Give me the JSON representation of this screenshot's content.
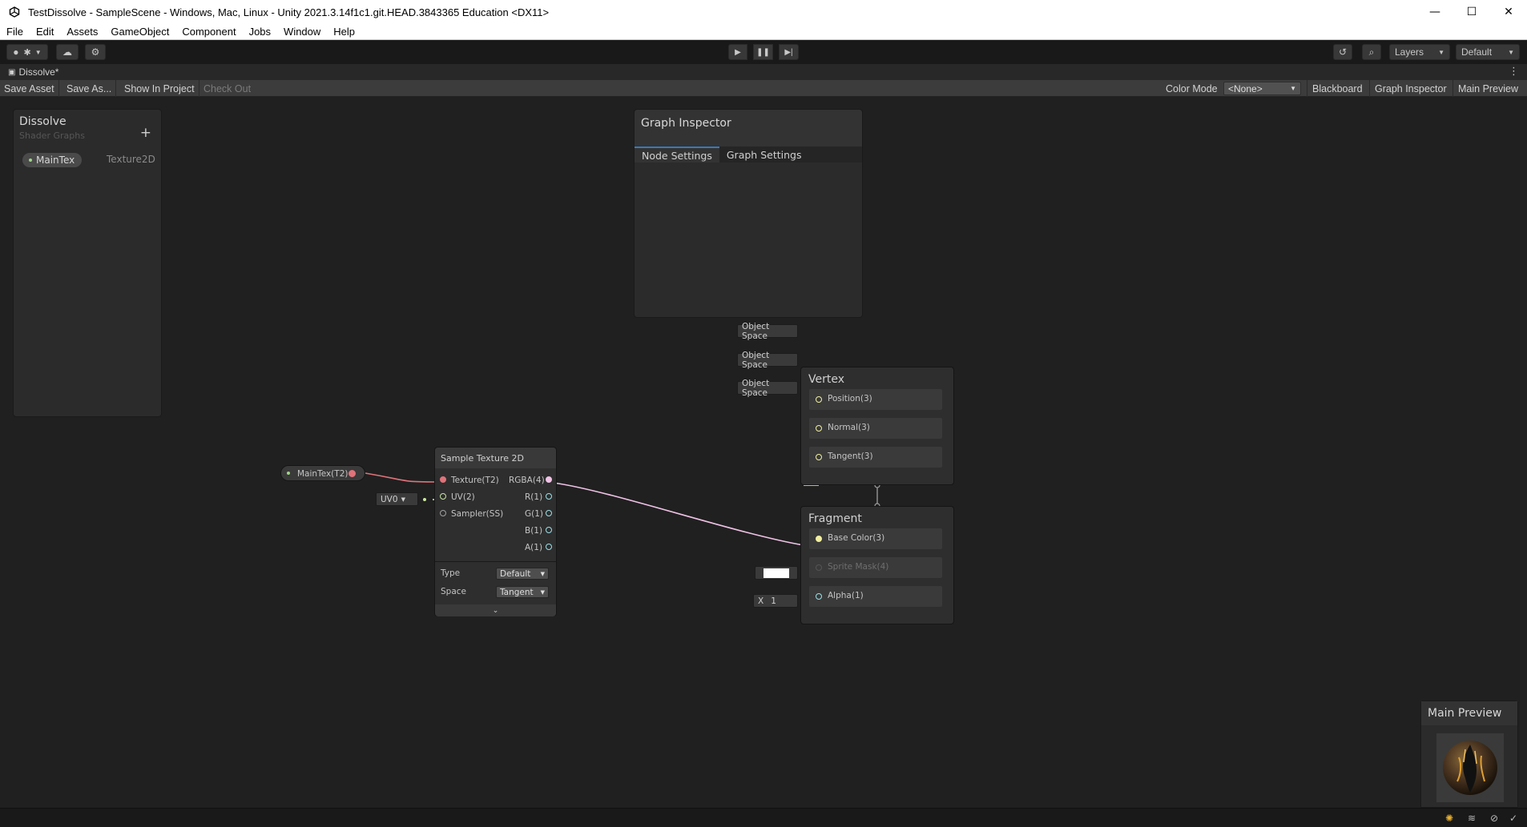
{
  "window": {
    "title": "TestDissolve - SampleScene - Windows, Mac, Linux - Unity 2021.3.14f1c1.git.HEAD.3843365 Education <DX11>",
    "minimize": "—",
    "maximize": "☐",
    "close": "✕"
  },
  "menu": [
    "File",
    "Edit",
    "Assets",
    "GameObject",
    "Component",
    "Jobs",
    "Window",
    "Help"
  ],
  "toolbar": {
    "layers_label": "Layers",
    "layout_label": "Default"
  },
  "tab": {
    "name": "Dissolve*"
  },
  "graph_toolbar": {
    "save_asset": "Save Asset",
    "save_as": "Save As...",
    "show_in_project": "Show In Project",
    "check_out": "Check Out",
    "color_mode_label": "Color Mode",
    "color_mode_value": "<None>",
    "blackboard": "Blackboard",
    "graph_inspector": "Graph Inspector",
    "main_preview": "Main Preview"
  },
  "blackboard": {
    "title": "Dissolve",
    "subtitle": "Shader Graphs",
    "add": "+",
    "properties": [
      {
        "name": "MainTex",
        "type": "Texture2D"
      }
    ]
  },
  "inspector": {
    "title": "Graph Inspector",
    "tabs": [
      "Node Settings",
      "Graph Settings"
    ]
  },
  "property_node": {
    "label": "MainTex(T2)"
  },
  "sample_texture": {
    "title": "Sample Texture 2D",
    "inputs": [
      "Texture(T2)",
      "UV(2)",
      "Sampler(SS)"
    ],
    "outputs": [
      "RGBA(4)",
      "R(1)",
      "G(1)",
      "B(1)",
      "A(1)"
    ],
    "uv_value": "UV0",
    "type_label": "Type",
    "type_value": "Default",
    "space_label": "Space",
    "space_value": "Tangent"
  },
  "vertex": {
    "title": "Vertex",
    "slots": [
      "Position(3)",
      "Normal(3)",
      "Tangent(3)"
    ],
    "space_value": "Object Space"
  },
  "fragment": {
    "title": "Fragment",
    "slots": [
      "Base Color(3)",
      "Sprite Mask(4)",
      "Alpha(1)"
    ],
    "alpha_axis": "X",
    "alpha_value": "1"
  },
  "preview": {
    "title": "Main Preview"
  },
  "colors": {
    "accent": "#3a79bb",
    "texture_wire": "#e0737a",
    "vector_wire": "#f2f0a0",
    "rgba_wire": "#f0c2e6"
  }
}
